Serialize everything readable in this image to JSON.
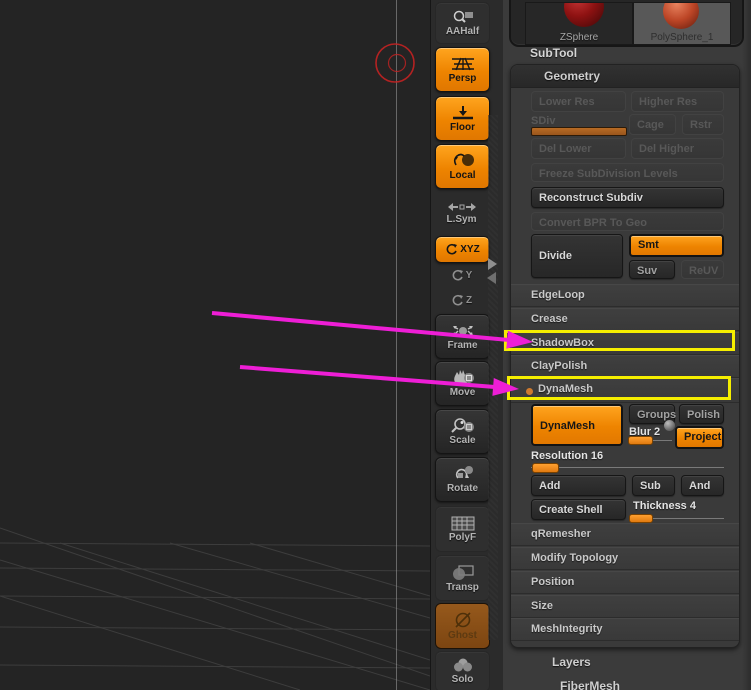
{
  "app": {
    "name": "ZBrush sculpting viewport"
  },
  "toolbar": {
    "items": [
      {
        "label": "AAHalf",
        "state": "flat"
      },
      {
        "label": "Persp",
        "state": "active-orange"
      },
      {
        "label": "Floor",
        "state": "active-orange"
      },
      {
        "label": "Local",
        "state": "active-orange"
      },
      {
        "label": "L.Sym",
        "state": "flat"
      },
      {
        "label": "XYZ",
        "state": "active-orange"
      },
      {
        "label": "Y",
        "state": "icon"
      },
      {
        "label": "Z",
        "state": "icon"
      },
      {
        "label": "Frame",
        "state": "raised"
      },
      {
        "label": "Move",
        "state": "raised"
      },
      {
        "label": "Scale",
        "state": "raised"
      },
      {
        "label": "Rotate",
        "state": "raised"
      },
      {
        "label": "PolyF",
        "state": "flat"
      },
      {
        "label": "Transp",
        "state": "flat"
      },
      {
        "label": "Ghost",
        "state": "ghosted-orange"
      },
      {
        "label": "Solo",
        "state": "flat"
      }
    ]
  },
  "tool_thumbnails": {
    "items": [
      {
        "label": "ZSphere",
        "selected": false
      },
      {
        "label": "PolySphere_1",
        "selected": true
      }
    ]
  },
  "subtool": {
    "header": "SubTool"
  },
  "geometry": {
    "header": "Geometry",
    "buttons": {
      "lower_res": "Lower Res",
      "higher_res": "Higher Res",
      "sdiv": "SDiv",
      "cage": "Cage",
      "rstr": "Rstr",
      "del_lower": "Del Lower",
      "del_higher": "Del Higher",
      "freeze": "Freeze SubDivision Levels",
      "reconstruct": "Reconstruct Subdiv",
      "convert_bpr": "Convert BPR To Geo",
      "divide": "Divide",
      "smt": "Smt",
      "suv": "Suv",
      "reuv": "ReUV"
    },
    "sections": {
      "edgeloop": "EdgeLoop",
      "crease": "Crease",
      "shadowbox": "ShadowBox",
      "claypolish": "ClayPolish",
      "dynamesh": "DynaMesh",
      "qremesher": "qRemesher",
      "modify_topology": "Modify Topology",
      "position": "Position",
      "size": "Size",
      "meshintegrity": "MeshIntegrity"
    },
    "dynamesh_panel": {
      "button": "DynaMesh",
      "groups": "Groups",
      "polish": "Polish",
      "blur": "Blur 2",
      "project": "Project",
      "resolution": "Resolution 16",
      "add": "Add",
      "sub": "Sub",
      "and": "And",
      "create_shell": "Create Shell",
      "thickness": "Thickness 4"
    }
  },
  "palettes": {
    "layers": "Layers",
    "fibermesh": "FiberMesh"
  },
  "annotations": {
    "highlighted_items": [
      "ShadowBox",
      "DynaMesh"
    ],
    "highlight_color": "#f5ee00",
    "arrow_color": "#ee1ed6",
    "cursor_color": "#c42222"
  },
  "colors": {
    "accent_orange": "#ee8400",
    "canvas_bg": "#242424",
    "tray_bg": "#3b3b3b"
  }
}
